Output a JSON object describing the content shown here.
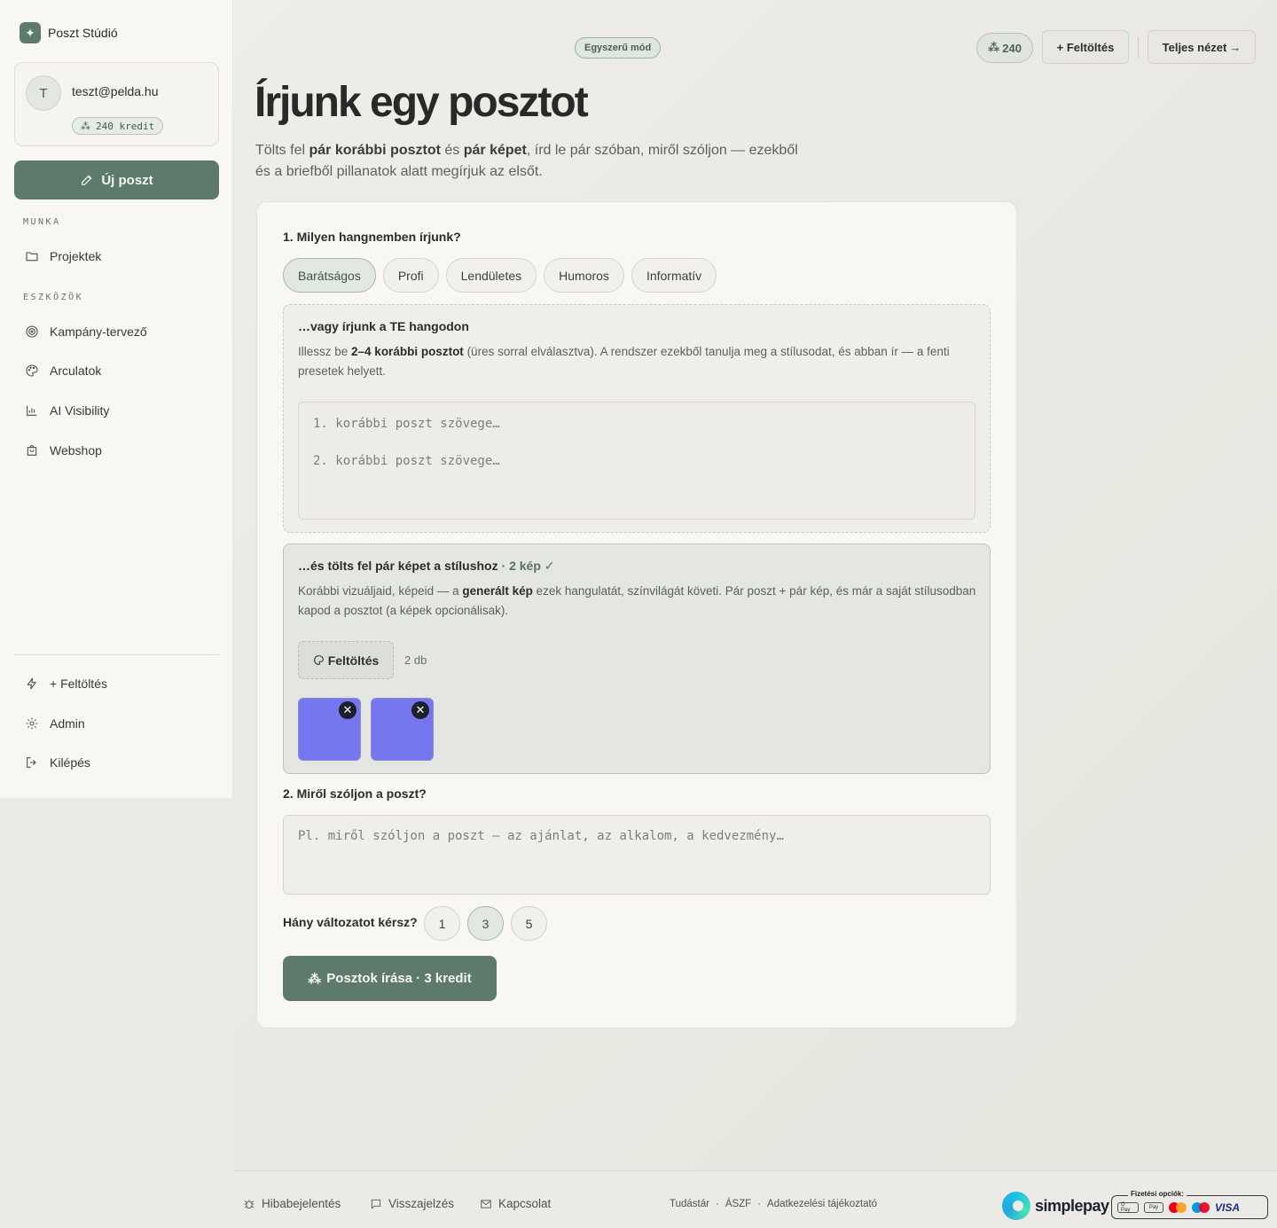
{
  "app": {
    "brand_name": "Poszt Stúdió"
  },
  "user": {
    "initial": "T",
    "email": "teszt@pelda.hu",
    "credits_label": "240 kredit"
  },
  "sidebar": {
    "new_post_label": "Új poszt",
    "section_work": "MUNKA",
    "section_tools": "ESZKÖZÖK",
    "items": [
      {
        "label": "Projektek",
        "icon": "folder-icon"
      },
      {
        "label": "Kampány-tervező",
        "icon": "target-icon"
      },
      {
        "label": "Arculatok",
        "icon": "palette-icon"
      },
      {
        "label": "AI Visibility",
        "icon": "bar-chart-icon"
      },
      {
        "label": "Webshop",
        "icon": "shopping-bag-icon"
      }
    ],
    "bottom_items": [
      {
        "label": "+ Feltöltés",
        "icon": "bolt-icon"
      },
      {
        "label": "Admin",
        "icon": "gear-icon"
      },
      {
        "label": "Kilépés",
        "icon": "logout-icon"
      }
    ]
  },
  "topbar": {
    "mode_label": "Egyszerű mód",
    "credits": "240",
    "upload_label": "+ Feltöltés",
    "full_view_label": "Teljes nézet"
  },
  "page": {
    "title": "Írjunk egy posztot",
    "subtitle_1": "Tölts fel ",
    "subtitle_b1": "pár korábbi posztot",
    "subtitle_2": " és ",
    "subtitle_b2": "pár képet",
    "subtitle_3": ", írd le pár szóban, miről szóljon — ezekből és a briefből pillanatok alatt megírjuk az elsőt."
  },
  "form": {
    "tone_question": "1. Milyen hangnemben írjunk?",
    "tones": [
      "Barátságos",
      "Profi",
      "Lendületes",
      "Humoros",
      "Informatív"
    ],
    "active_tone": "Barátságos",
    "voice_title": "…vagy írjunk a TE hangodon",
    "voice_text_1": "Illessz be ",
    "voice_text_b": "2–4 korábbi posztot",
    "voice_text_2": " (üres sorral elválasztva). A rendszer ezekből tanulja meg a stílusodat, és abban ír — a fenti presetek helyett.",
    "voice_placeholder_1": "1. korábbi poszt szövege…",
    "voice_placeholder_2": "2. korábbi poszt szövege…",
    "image_title": "…és tölts fel pár képet a stílushoz",
    "image_count": "· 2 kép ✓",
    "image_text_1": "Korábbi vizuáljaid, képeid — a ",
    "image_text_b": "generált kép",
    "image_text_2": " ezek hangulatát, színvilágát követi. Pár poszt + pár kép, és már a saját stílusodban kapod a posztot (a képek opcionálisak).",
    "upload_label": "Feltöltés",
    "upload_count": "2 db",
    "thumb_color": "#7676ee",
    "topic_question": "2. Miről szóljon a poszt?",
    "topic_placeholder": "Pl. miről szóljon a poszt — az ajánlat, az alkalom, a kedvezmény…",
    "variant_question": "Hány változatot kérsz?",
    "variants": [
      "1",
      "3",
      "5"
    ],
    "active_variant": "3",
    "submit_label": "Posztok írása · 3 kredit"
  },
  "footer": {
    "bug_report": "Hibabejelentés",
    "feedback": "Visszajelzés",
    "contact": "Kapcsolat",
    "legal": [
      "Tudástár",
      "ÁSZF",
      "Adatkezelési tájékoztató"
    ],
    "legal_sep": "·",
    "payment_brand": "simplepay",
    "payment_options_label": "Fizetési opciók:",
    "payment_cards": [
      "G Pay",
      "Pay",
      "VISA"
    ]
  },
  "colors": {
    "accent": "#5e7a6c",
    "background": "#ebeae6",
    "card": "#f8f7f3"
  }
}
